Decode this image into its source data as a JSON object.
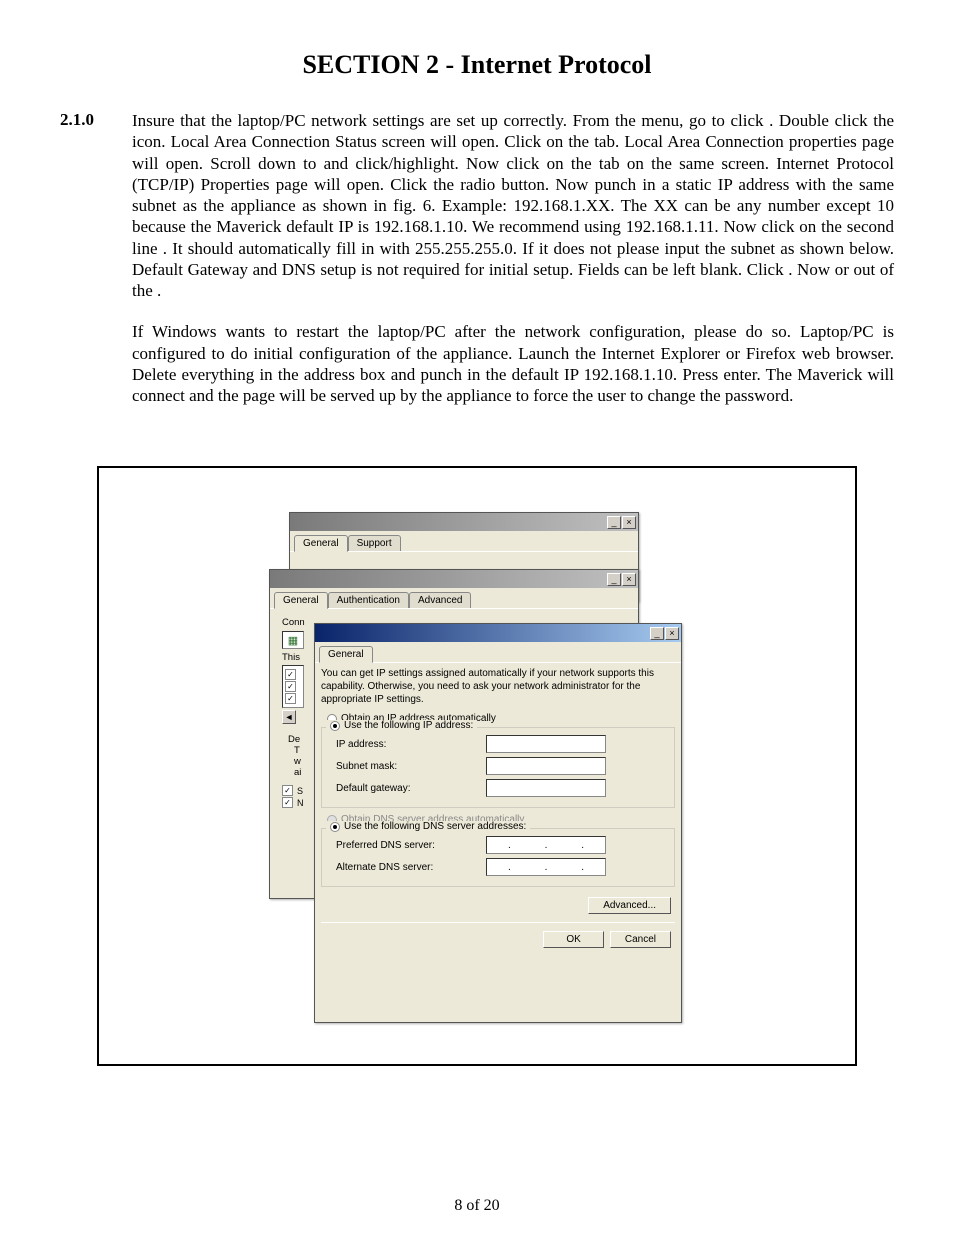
{
  "title": "SECTION 2 - Internet Protocol",
  "section_number": "2.1.0",
  "para1": "Insure that the laptop/PC network settings are set up correctly. From the   menu, go to click   . Double click the   icon. Local Area Connection Status screen will open. Click on the   tab. Local Area Connection properties page will open. Scroll down to   and click/highlight. Now click on the   tab on the same screen. Internet Protocol (TCP/IP) Properties page will open. Click the   radio button. Now punch in a static IP address with the same subnet as the appliance as shown in fig. 6. Example: 192.168.1.XX. The XX can be any number except 10 because the Maverick default IP is 192.168.1.10. We recommend using 192.168.1.11. Now click on the second line   . It should automatically fill in with 255.255.255.0. If it does not please input the subnet as shown below. Default Gateway and DNS setup is not required for initial setup. Fields can be left blank. Click   . Now   or   out of the   .",
  "para2": "If Windows wants to restart the laptop/PC after the network configuration, please do so. Laptop/PC is configured to do initial configuration of the appliance. Launch the Internet Explorer or Firefox web browser. Delete everything in the address box and punch in the default IP 192.168.1.10. Press enter. The Maverick will connect and the   page will be served up by the appliance to force the user to change the password.",
  "win1": {
    "tabs": {
      "general": "General",
      "support": "Support"
    }
  },
  "win2": {
    "tabs": {
      "general": "General",
      "auth": "Authentication",
      "adv": "Advanced"
    },
    "conn": "Conn",
    "this": "This",
    "de": "De",
    "t": "T",
    "w": "w",
    "ai": "ai"
  },
  "win3": {
    "tab": "General",
    "desc": "You can get IP settings assigned automatically if your network supports this capability. Otherwise, you need to ask your network administrator for the appropriate IP settings.",
    "r1": "Obtain an IP address automatically",
    "r2": "Use the following IP address:",
    "ip_label": "IP address:",
    "subnet_label": "Subnet mask:",
    "gateway_label": "Default gateway:",
    "r3": "Obtain DNS server address automatically",
    "r4": "Use the following DNS server addresses:",
    "pref_dns": "Preferred DNS server:",
    "alt_dns": "Alternate DNS server:",
    "advanced": "Advanced...",
    "ok": "OK",
    "cancel": "Cancel"
  },
  "footer": "8 of 20"
}
